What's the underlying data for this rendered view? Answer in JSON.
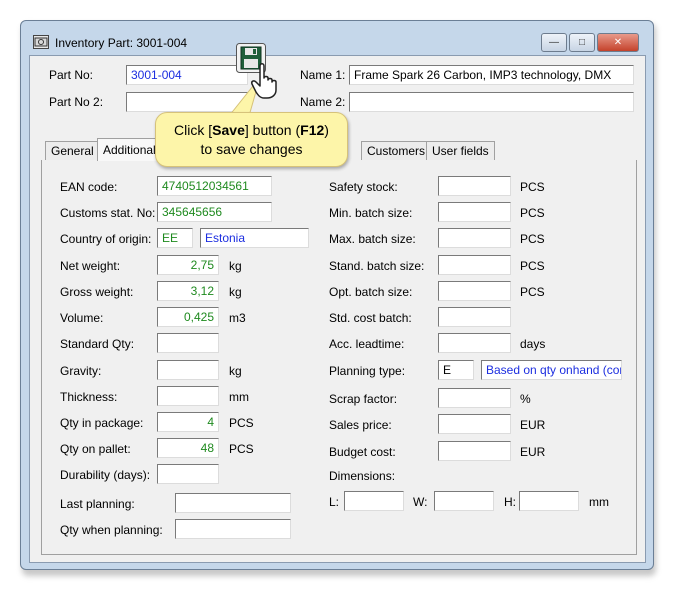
{
  "window": {
    "title": "Inventory Part: 3001-004",
    "controls": {
      "minimize": "—",
      "maximize": "□",
      "close": "✕"
    }
  },
  "header": {
    "part_no_label": "Part No:",
    "part_no_value": "3001-004",
    "part_no2_label": "Part No 2:",
    "part_no2_value": "",
    "name1_label": "Name 1:",
    "name1_value": "Frame Spark 26 Carbon, IMP3 technology, DMX",
    "name2_label": "Name 2:",
    "name2_value": ""
  },
  "tabs": {
    "general": "General",
    "additional": "Additional",
    "customers": "Customers",
    "user_fields": "User fields"
  },
  "callout": {
    "line1_pre": "Click [",
    "line1_bold": "Save",
    "line1_mid": "] button (",
    "line1_key": "F12",
    "line1_post": ")",
    "line2": "to save changes"
  },
  "left": {
    "ean_label": "EAN code:",
    "ean_value": "4740512034561",
    "customs_label": "Customs stat. No:",
    "customs_value": "345645656",
    "country_label": "Country of origin:",
    "country_code": "EE",
    "country_name": "Estonia",
    "net_label": "Net weight:",
    "net_value": "2,75",
    "net_unit": "kg",
    "gross_label": "Gross weight:",
    "gross_value": "3,12",
    "gross_unit": "kg",
    "volume_label": "Volume:",
    "volume_value": "0,425",
    "volume_unit": "m3",
    "stdqty_label": "Standard Qty:",
    "stdqty_value": "",
    "gravity_label": "Gravity:",
    "gravity_value": "",
    "gravity_unit": "kg",
    "thickness_label": "Thickness:",
    "thickness_value": "",
    "thickness_unit": "mm",
    "qtypkg_label": "Qty in package:",
    "qtypkg_value": "4",
    "qtypkg_unit": "PCS",
    "qtypal_label": "Qty on pallet:",
    "qtypal_value": "48",
    "qtypal_unit": "PCS",
    "durability_label": "Durability (days):",
    "durability_value": "",
    "lastplan_label": "Last planning:",
    "lastplan_value": "",
    "qtyplan_label": "Qty when planning:",
    "qtyplan_value": ""
  },
  "right": {
    "safety_label": "Safety stock:",
    "safety_value": "",
    "safety_unit": "PCS",
    "minbatch_label": "Min. batch size:",
    "minbatch_value": "",
    "minbatch_unit": "PCS",
    "maxbatch_label": "Max. batch size:",
    "maxbatch_value": "",
    "maxbatch_unit": "PCS",
    "stdbatch_label": "Stand. batch size:",
    "stdbatch_value": "",
    "stdbatch_unit": "PCS",
    "optbatch_label": "Opt. batch size:",
    "optbatch_value": "",
    "optbatch_unit": "PCS",
    "stdcost_label": "Std. cost batch:",
    "stdcost_value": "",
    "leadtime_label": "Acc. leadtime:",
    "leadtime_value": "",
    "leadtime_unit": "days",
    "plantype_label": "Planning type:",
    "plantype_code": "E",
    "plantype_desc": "Based on qty onhand (cor",
    "scrap_label": "Scrap factor:",
    "scrap_value": "",
    "scrap_unit": "%",
    "sales_label": "Sales price:",
    "sales_value": "",
    "sales_unit": "EUR",
    "budget_label": "Budget cost:",
    "budget_value": "",
    "budget_unit": "EUR",
    "dims_label": "Dimensions:",
    "l_label": "L:",
    "l_value": "",
    "w_label": "W:",
    "w_value": "",
    "h_label": "H:",
    "h_value": "",
    "dims_unit": "mm"
  },
  "icons": {
    "window": "inventory-part-icon",
    "save": "floppy-disk-icon",
    "pointer": "hand-pointer-icon"
  },
  "colors": {
    "green_text": "#1f8a1f",
    "blue_text": "#1c2ee0",
    "callout_bg": "#fdf5a9"
  }
}
